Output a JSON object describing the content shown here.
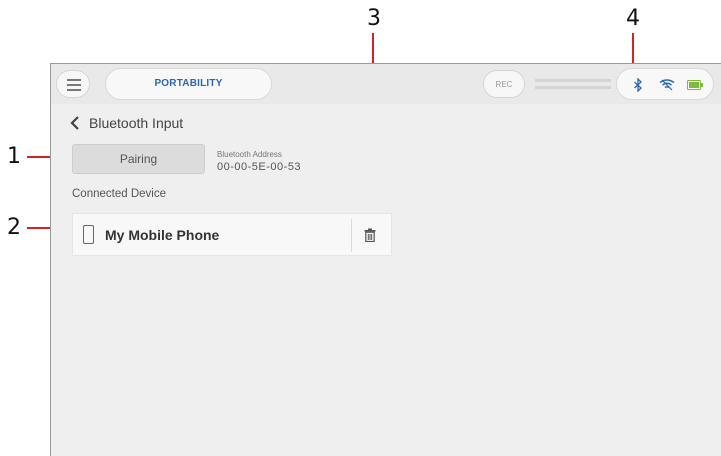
{
  "callouts": [
    "1",
    "2",
    "3",
    "4"
  ],
  "header": {
    "mode_label": "PORTABILITY",
    "rec_label": "REC",
    "status_icons": [
      "bluetooth-icon",
      "wifi-icon",
      "battery-icon"
    ]
  },
  "screen": {
    "title": "Bluetooth Input",
    "pairing_button": "Pairing",
    "bluetooth_address_label": "Bluetooth Address",
    "bluetooth_address": "00-00-5E-00-53",
    "connected_device_label": "Connected Device",
    "device": {
      "name": "My Mobile Phone",
      "icon": "phone-icon",
      "delete_icon": "trash-icon"
    }
  },
  "colors": {
    "accent": "#2a66b4",
    "callout_line": "#d2232a",
    "bluetooth_icon": "#2a66b4",
    "battery_fill": "#7dbb3a",
    "screen_bg": "#efefef"
  }
}
